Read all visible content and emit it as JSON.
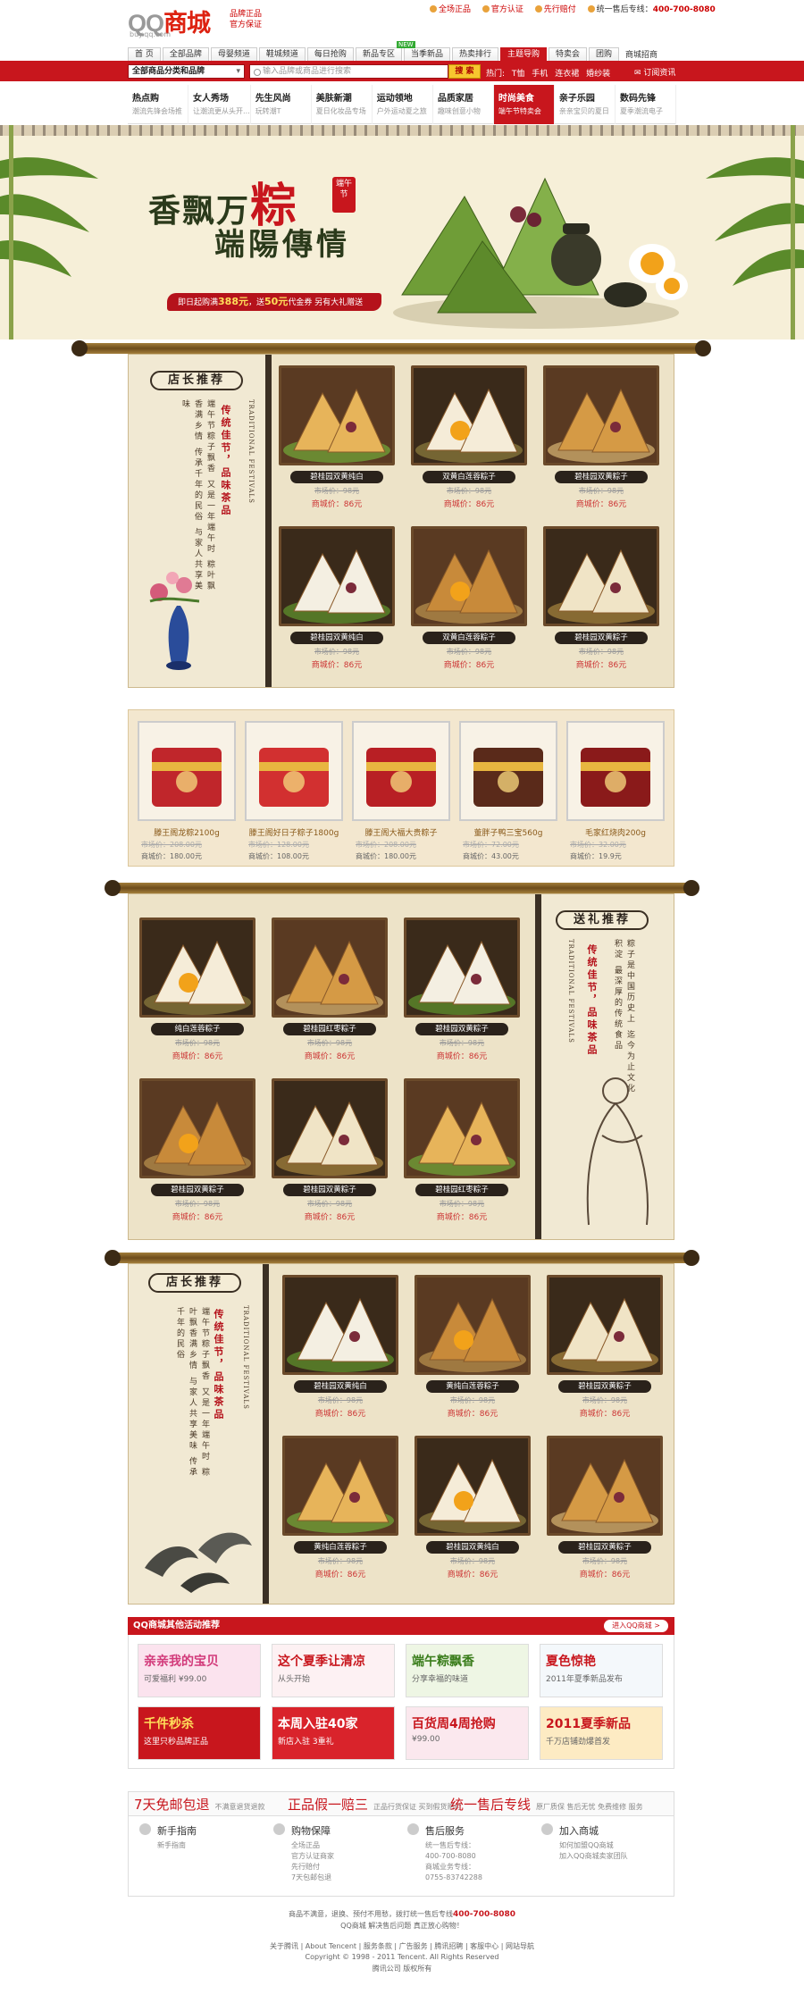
{
  "header": {
    "logo_prefix": "QQ",
    "logo_main": "商城",
    "logo_sub": "buy.qq.com",
    "slogan": [
      "品牌正品",
      "官方保证"
    ],
    "top_links": [
      "全场正品",
      "官方认证",
      "先行赔付"
    ],
    "hotline_label": "统一售后专线：",
    "hotline": "400-700-8080"
  },
  "nav": {
    "tabs": [
      "首 页",
      "全部品牌",
      "母婴频道",
      "鞋城频道",
      "每日抢购",
      "新品专区",
      "当季新品",
      "热卖排行",
      "主题导购",
      "特卖会",
      "团购"
    ],
    "new_badge": "NEW",
    "more": "商城招商"
  },
  "searchbar": {
    "category": "全部商品分类和品牌",
    "placeholder": "输入品牌或商品进行搜索",
    "button": "搜 索",
    "hot_label": "热门:",
    "hot_words": [
      "T恤",
      "手机",
      "连衣裙",
      "婚纱装"
    ],
    "orders": "订阅资讯"
  },
  "categories": [
    {
      "title": "热点购",
      "sub": "潮流先锋会场推"
    },
    {
      "title": "女人秀场",
      "sub": "让潮流更从头开..."
    },
    {
      "title": "先生风尚",
      "sub": "玩转潮T"
    },
    {
      "title": "美肤新潮",
      "sub": "夏日化妆品专场"
    },
    {
      "title": "运动领地",
      "sub": "户外运动夏之旅"
    },
    {
      "title": "品质家居",
      "sub": "趣味创意小物"
    },
    {
      "title": "时尚美食",
      "sub": "端午节特卖会"
    },
    {
      "title": "亲子乐园",
      "sub": "亲亲宝贝的夏日"
    },
    {
      "title": "数码先锋",
      "sub": "夏季潮流电子"
    }
  ],
  "banner": {
    "title1_a": "香飘万",
    "title1_b": "粽",
    "seal": "端午节",
    "title2": "端陽傳情",
    "promo_a": "即日起购满",
    "promo_b": "388元",
    "promo_c": "，送",
    "promo_d": "50元",
    "promo_e": "代金券 另有大礼赠送"
  },
  "section1": {
    "badge": "店长推荐",
    "poem": [
      "端午节粽子飘香",
      "传统佳节，品味茶品",
      "又是一年端午时",
      "粽叶飘香满乡情",
      "传承千年的民俗",
      "与家人共享美味"
    ],
    "red_vertical": "传统佳节，品味茶品",
    "eng_vertical": "TRADITIONAL FESTIVALS",
    "products": [
      {
        "name": "碧桂园双黄纯白",
        "old": "市场价：98元",
        "price": "商城价：86元"
      },
      {
        "name": "双黄白莲蓉粽子",
        "old": "市场价：98元",
        "price": "商城价：86元"
      },
      {
        "name": "碧桂园双黄粽子",
        "old": "市场价：98元",
        "price": "商城价：86元"
      },
      {
        "name": "碧桂园双黄纯白",
        "old": "市场价：98元",
        "price": "商城价：86元"
      },
      {
        "name": "双黄白莲蓉粽子",
        "old": "市场价：98元",
        "price": "商城价：86元"
      },
      {
        "name": "碧桂园双黄粽子",
        "old": "市场价：98元",
        "price": "商城价：86元"
      }
    ]
  },
  "gifts": [
    {
      "name": "滕王阁龙粽2100g",
      "old": "市场价：208.00元",
      "price": "商城价：180.00元"
    },
    {
      "name": "滕王阁好日子粽子1800g",
      "old": "市场价：128.00元",
      "price": "商城价：108.00元"
    },
    {
      "name": "滕王阁大福大贵粽子",
      "old": "市场价：208.00元",
      "price": "商城价：180.00元"
    },
    {
      "name": "董胖子鸭三宝560g",
      "old": "市场价：72.00元",
      "price": "商城价：43.00元"
    },
    {
      "name": "毛家红烧肉200g",
      "old": "市场价：32.00元",
      "price": "商城价：19.9元"
    }
  ],
  "section2": {
    "badge": "送礼推荐",
    "poem": [
      "粽子是中国历史上",
      "迄今为止文化积淀",
      "最深厚的传统食品",
      "传统佳节，品味茶品"
    ],
    "red_vertical": "传统佳节，品味茶品",
    "eng_vertical": "TRADITIONAL FESTIVALS",
    "products": [
      {
        "name": "纯白莲蓉粽子",
        "old": "市场价：98元",
        "price": "商城价：86元"
      },
      {
        "name": "碧桂园红枣粽子",
        "old": "市场价：98元",
        "price": "商城价：86元"
      },
      {
        "name": "碧桂园双黄粽子",
        "old": "市场价：98元",
        "price": "商城价：86元"
      },
      {
        "name": "碧桂园双黄粽子",
        "old": "市场价：98元",
        "price": "商城价：86元"
      },
      {
        "name": "碧桂园双黄粽子",
        "old": "市场价：98元",
        "price": "商城价：86元"
      },
      {
        "name": "碧桂园红枣粽子",
        "old": "市场价：98元",
        "price": "商城价：86元"
      }
    ]
  },
  "section3": {
    "badge": "店长推荐",
    "poem": [
      "端午节粽子飘香",
      "又是一年端午时",
      "粽叶飘香满乡情",
      "与家人共享美味",
      "传承千年的民俗"
    ],
    "red_vertical": "传统佳节，品味茶品",
    "eng_vertical": "TRADITIONAL FESTIVALS",
    "products": [
      {
        "name": "碧桂园双黄纯白",
        "old": "市场价：98元",
        "price": "商城价：86元"
      },
      {
        "name": "黄纯白莲蓉粽子",
        "old": "市场价：98元",
        "price": "商城价：86元"
      },
      {
        "name": "碧桂园双黄粽子",
        "old": "市场价：98元",
        "price": "商城价：86元"
      },
      {
        "name": "黄纯白莲蓉粽子",
        "old": "市场价：98元",
        "price": "商城价：86元"
      },
      {
        "name": "碧桂园双黄纯白",
        "old": "市场价：98元",
        "price": "商城价：86元"
      },
      {
        "name": "碧桂园双黄粽子",
        "old": "市场价：98元",
        "price": "商城价：86元"
      }
    ]
  },
  "activities": {
    "title": "QQ商城其他活动推荐",
    "more": "进入QQ商城 >",
    "ads": [
      {
        "t1": "亲亲我的宝贝",
        "t2": "可爱福利 ¥99.00",
        "bg": "#fbe3ee",
        "c": "#d23a7a"
      },
      {
        "t1": "这个夏季让清凉",
        "t2": "从头开始",
        "bg": "#fdf1f3",
        "c": "#c8161d"
      },
      {
        "t1": "端午粽飘香",
        "t2": "分享幸福的味道",
        "bg": "#eef6e4",
        "c": "#3a7d1b"
      },
      {
        "t1": "夏色惊艳",
        "t2": "2011年夏季新品发布",
        "bg": "#f4f8fb",
        "c": "#c8161d"
      },
      {
        "t1": "千件秒杀",
        "t2": "这里只秒品牌正品",
        "bg": "#c8161d",
        "c": "#ffde5a"
      },
      {
        "t1": "本周入驻40家",
        "t2": "新店入驻 3重礼",
        "bg": "#d9232b",
        "c": "#fff"
      },
      {
        "t1": "百货周4周抢购",
        "t2": "¥99.00",
        "bg": "#fbe8ee",
        "c": "#c8161d"
      },
      {
        "t1": "2011夏季新品",
        "t2": "千万店铺劲爆首发",
        "bg": "#fdebc3",
        "c": "#c8161d"
      }
    ]
  },
  "guarantees": [
    {
      "big": "7天免邮包退",
      "small": "不满意退货退款"
    },
    {
      "big": "正品假一赔三",
      "small": "正品行货保证 买到假货赔付"
    },
    {
      "big": "统一售后专线",
      "small": "原厂质保 售后无忧 免费维修 服务"
    }
  ],
  "help": [
    {
      "title": "新手指南",
      "links": "新手指南"
    },
    {
      "title": "购物保障",
      "links": "全场正品\n官方认证商家\n先行赔付\n7天包邮包退"
    },
    {
      "title": "售后服务",
      "links": "统一售后专线：\n400-700-8080\n商城业务专线：\n0755-83742288"
    },
    {
      "title": "加入商城",
      "links": "如何加盟QQ商城\n加入QQ商城卖家团队"
    }
  ],
  "footer": {
    "line1_a": "商品不满意，退换、预付不用愁，拨打统一售后专线",
    "line1_b": "400-700-8080",
    "line2": "QQ商城 解决售后问题 真正放心购物！",
    "links": "关于腾讯 | About Tencent | 服务条款 | 广告服务 | 腾讯招聘 | 客服中心 | 网站导航",
    "copyright": "Copyright © 1998 - 2011 Tencent. All Rights Reserved",
    "company": "腾讯公司 版权所有"
  },
  "colors": {
    "brand_red": "#c8161d",
    "gold": "#f7c62f",
    "parchment": "#ede3c8"
  }
}
